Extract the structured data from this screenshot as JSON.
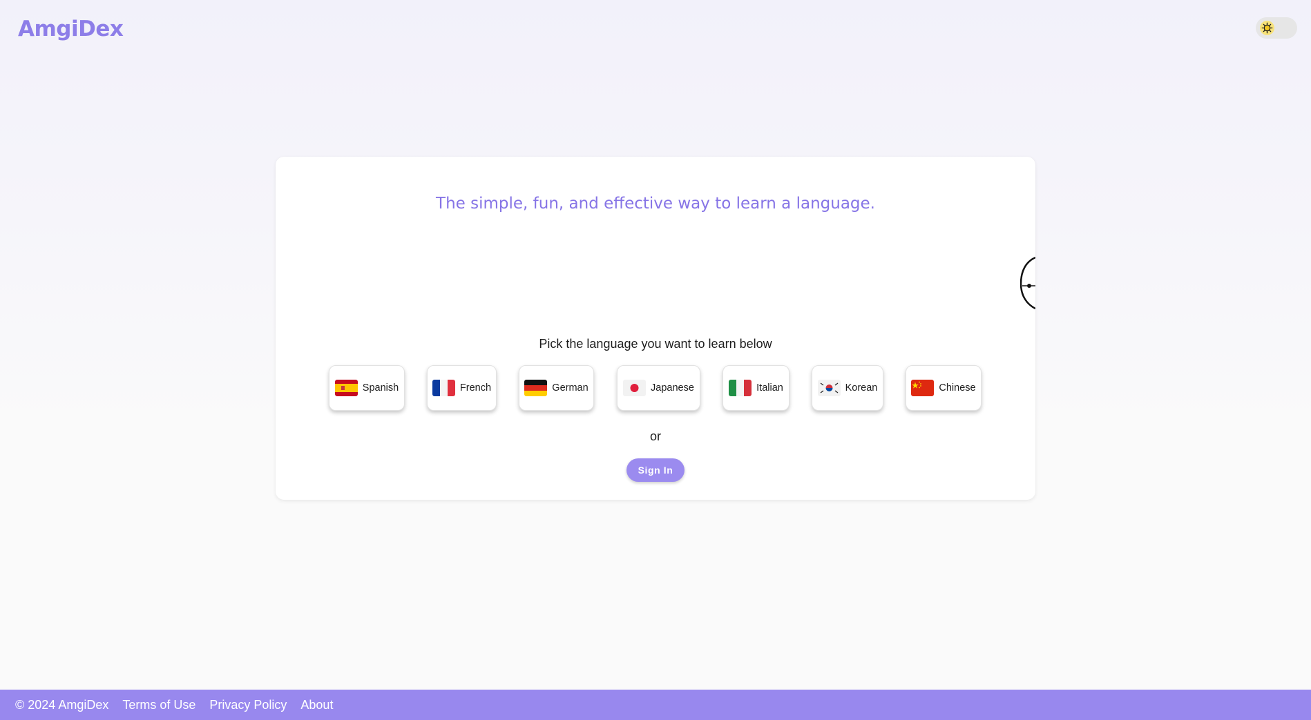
{
  "header": {
    "logo": "AmgiDex",
    "theme_toggle_icon": "sun-icon"
  },
  "main": {
    "tagline": "The simple, fun, and effective way to learn a language.",
    "pick_prompt": "Pick the language you want to learn below",
    "languages": [
      {
        "label": "Spanish",
        "flag": "spain-flag-icon"
      },
      {
        "label": "French",
        "flag": "france-flag-icon"
      },
      {
        "label": "German",
        "flag": "germany-flag-icon"
      },
      {
        "label": "Japanese",
        "flag": "japan-flag-icon"
      },
      {
        "label": "Italian",
        "flag": "italy-flag-icon"
      },
      {
        "label": "Korean",
        "flag": "korea-flag-icon"
      },
      {
        "label": "Chinese",
        "flag": "china-flag-icon"
      }
    ],
    "or_text": "or",
    "signin_label": "Sign In"
  },
  "footer": {
    "copyright": "© 2024 AmgiDex",
    "links": [
      "Terms of Use",
      "Privacy Policy",
      "About"
    ]
  },
  "colors": {
    "brand": "#8d7ee8",
    "button": "#9b8bef",
    "footer_bg": "#9888ee"
  }
}
